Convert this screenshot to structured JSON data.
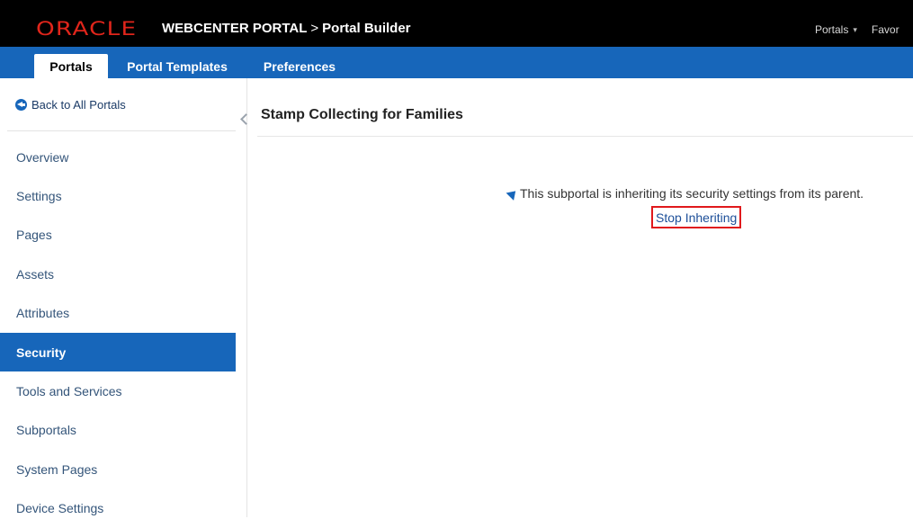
{
  "header": {
    "logo_text": "ORACLE",
    "product": "WEBCENTER PORTAL",
    "separator": ">",
    "app_name": "Portal Builder",
    "menu": [
      {
        "label": "Portals"
      },
      {
        "label": "Favor"
      }
    ]
  },
  "tabs": [
    {
      "label": "Portals",
      "active": true
    },
    {
      "label": "Portal Templates",
      "active": false
    },
    {
      "label": "Preferences",
      "active": false
    }
  ],
  "sidebar": {
    "back_label": "Back to All Portals",
    "items": [
      {
        "label": "Overview",
        "active": false
      },
      {
        "label": "Settings",
        "active": false
      },
      {
        "label": "Pages",
        "active": false
      },
      {
        "label": "Assets",
        "active": false
      },
      {
        "label": "Attributes",
        "active": false
      },
      {
        "label": "Security",
        "active": true
      },
      {
        "label": "Tools and Services",
        "active": false
      },
      {
        "label": "Subportals",
        "active": false
      },
      {
        "label": "System Pages",
        "active": false
      },
      {
        "label": "Device Settings",
        "active": false
      }
    ]
  },
  "main": {
    "title": "Stamp Collecting for Families",
    "message": "This subportal is inheriting its security settings from its parent.",
    "action_label": "Stop Inheriting"
  },
  "colors": {
    "brand_red": "#e0251b",
    "accent_blue": "#1766ba",
    "highlight_red": "#e0191c"
  },
  "icons": {
    "back": "arrow-left-circle-icon",
    "message": "pin-icon",
    "collapse": "chevron-left-icon",
    "menu_caret": "caret-down-icon"
  }
}
